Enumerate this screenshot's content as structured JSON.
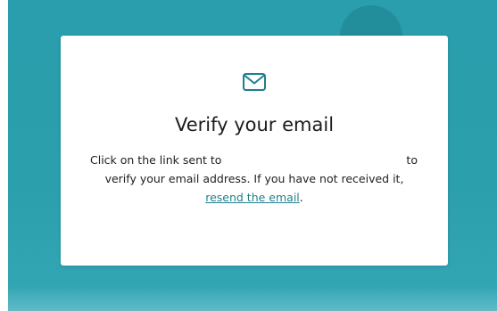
{
  "card": {
    "icon": "envelope-icon",
    "title": "Verify your email",
    "message_part1": "Click on the link sent to",
    "message_part2": "to",
    "message_part3": "verify your email address. If you have not received it,",
    "resend_link": "resend the email",
    "message_end": "."
  },
  "colors": {
    "background": "#2c9fad",
    "accent": "#1f7f8c",
    "card": "#ffffff",
    "text": "#1e1e1e"
  }
}
